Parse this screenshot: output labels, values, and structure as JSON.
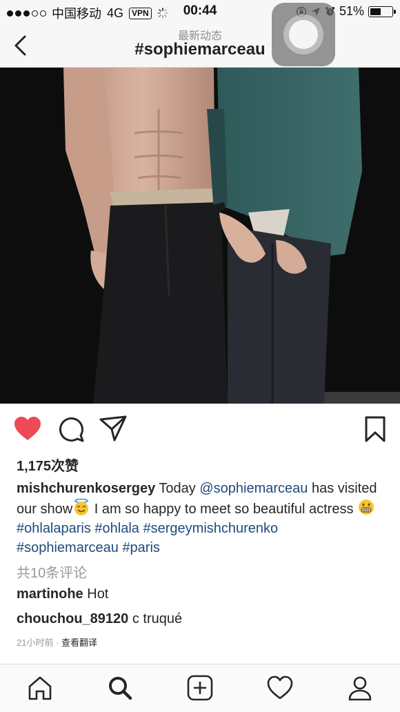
{
  "status_bar": {
    "carrier": "中国移动",
    "network": "4G",
    "vpn": "VPN",
    "time": "00:44",
    "battery": "51%",
    "battery_level": 0.51
  },
  "nav": {
    "subtitle": "最新动态",
    "title": "#sophiemarceau"
  },
  "post": {
    "likes": "1,175次赞",
    "caption": {
      "username": "mishchurenkosergey",
      "text1": " Today ",
      "mention": "@sophiemarceau",
      "text2": " has visited our show",
      "text3": " I am so happy to meet so beautiful actress ",
      "tag1": "#ohlalaparis",
      "tag2": "#ohlala",
      "tag3": "#sergeymishchurenko",
      "tag4": "#sophiemarceau",
      "tag5": "#paris"
    },
    "view_comments": "共10条评论",
    "comments": [
      {
        "username": "martinohe",
        "text": " Hot"
      },
      {
        "username": "chouchou_89120",
        "text": " c truqué"
      }
    ],
    "time_ago": "21小时前",
    "separator": " · ",
    "translate": "查看翻译"
  },
  "icons": {
    "like": "heart-icon",
    "comment": "comment-icon",
    "share": "share-icon",
    "save": "bookmark-icon",
    "tabs": [
      "home-icon",
      "search-icon",
      "add-icon",
      "activity-icon",
      "profile-icon"
    ]
  },
  "colors": {
    "like_red": "#ed4956",
    "link_blue": "#1e4a7c",
    "muted_gray": "#999999"
  }
}
